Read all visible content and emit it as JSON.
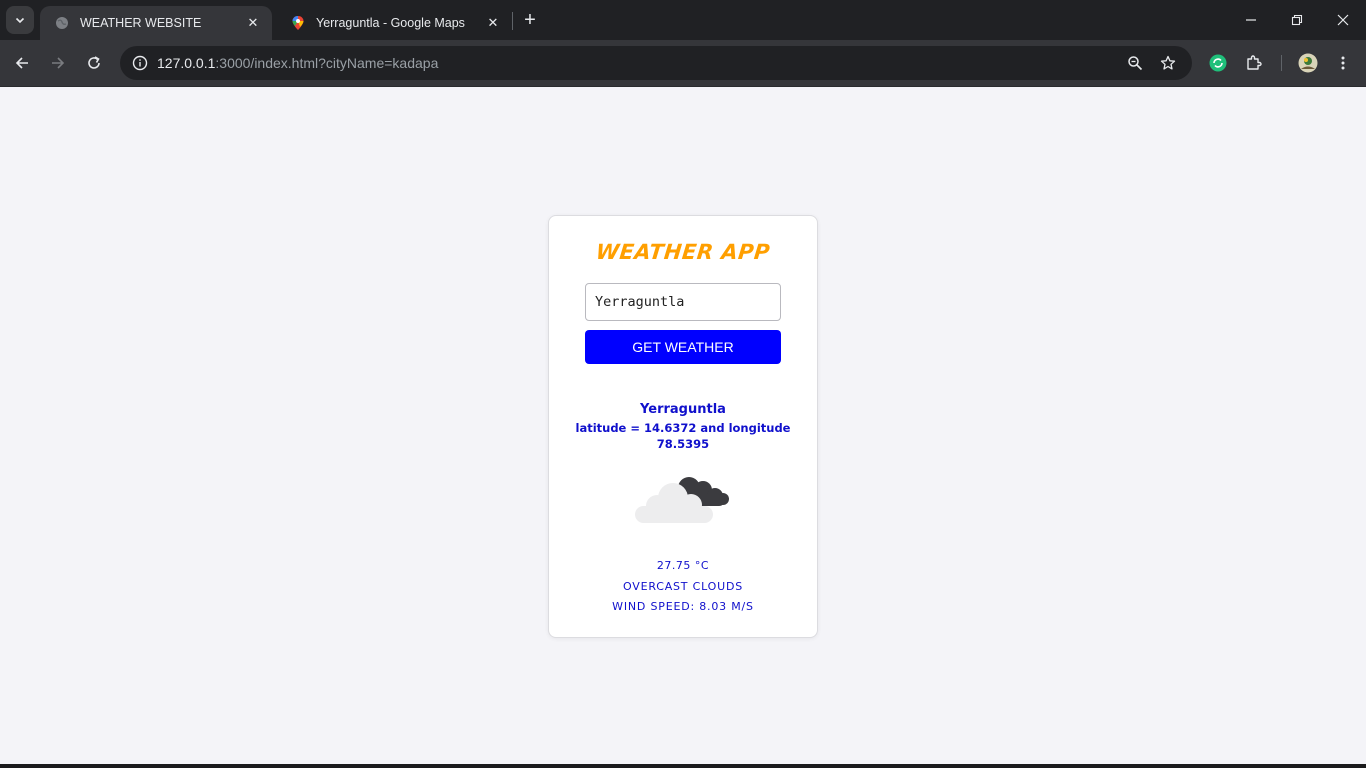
{
  "browser": {
    "tabs": [
      {
        "title": "WEATHER WEBSITE",
        "active": true
      },
      {
        "title": "Yerraguntla - Google Maps",
        "active": false
      }
    ],
    "url": {
      "host": "127.0.0.1",
      "rest": ":3000/index.html?cityName=kadapa"
    }
  },
  "app": {
    "title": "WEATHER APP",
    "input": {
      "value": "Yerraguntla",
      "placeholder": ""
    },
    "button_label": "GET WEATHER",
    "result": {
      "city": "Yerraguntla",
      "coordinates": "latitude = 14.6372 and longitude 78.5395",
      "icon": "overcast-clouds-icon",
      "temperature": "27.75 °C",
      "description": "OVERCAST CLOUDS",
      "wind": "WIND SPEED: 8.03 M/S"
    }
  },
  "colors": {
    "accent_title": "#ff9f00",
    "button": "#0000ff",
    "result_text": "#1010cc",
    "page_bg": "#f4f4f8"
  }
}
